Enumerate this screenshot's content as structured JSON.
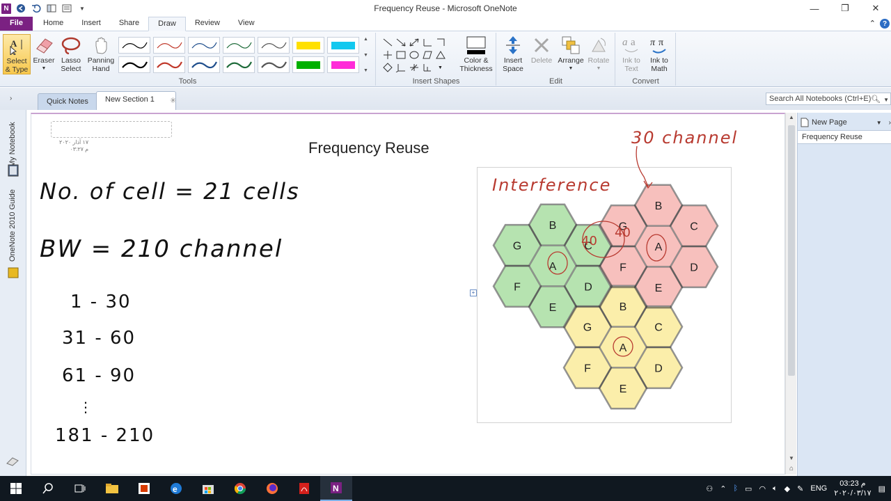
{
  "window": {
    "title": "Frequency Reuse - Microsoft OneNote",
    "app_icon": "N"
  },
  "ribbon_tabs": [
    "File",
    "Home",
    "Insert",
    "Share",
    "Draw",
    "Review",
    "View"
  ],
  "active_tab": "Draw",
  "ribbon": {
    "tools_buttons": {
      "select_type": "Select & Type",
      "eraser": "Eraser",
      "lasso": "Lasso Select",
      "panning": "Panning Hand"
    },
    "tools_label": "Tools",
    "color_thickness": "Color & Thickness",
    "insert_shapes_label": "Insert Shapes",
    "edit_buttons": {
      "insert_space": "Insert Space",
      "delete": "Delete",
      "arrange": "Arrange",
      "rotate": "Rotate"
    },
    "edit_label": "Edit",
    "convert_buttons": {
      "ink_to_text": "Ink to Text",
      "ink_to_math": "Ink to Math"
    },
    "convert_label": "Convert",
    "pen_colors": [
      "#000000",
      "#c0392b",
      "#1f4e8c",
      "#1e6b3a",
      "#555555",
      "#ffe000",
      "#12c8ef",
      "#000000",
      "#c0392b",
      "#1f4e8c",
      "#1e6b3a",
      "#555555",
      "#00b000",
      "#ff2bd8"
    ]
  },
  "sections": {
    "quick_notes": "Quick Notes",
    "new_section": "New Section 1"
  },
  "search": {
    "placeholder": "Search All Notebooks (Ctrl+E)"
  },
  "notebook_bar": {
    "my_notebook": "My Notebook",
    "guide": "OneNote 2010 Guide"
  },
  "page": {
    "title": "Frequency Reuse",
    "date_line1": "١٧ آذار ٢٠٢٠",
    "date_line2": "م ٠٣:٢٧"
  },
  "handwriting": {
    "cells": "No. of cell = 21 cells",
    "bw": "BW = 210 channel",
    "range1": "1 - 30",
    "range2": "31 - 60",
    "range3": "61 - 90",
    "dots": "⋮",
    "range4": "181 - 210",
    "note_30": "30 channel",
    "note_interference": "Interference",
    "note_40a": "40",
    "note_40b": "40"
  },
  "hex_clusters": {
    "colors": {
      "green": "#b6e3b0",
      "red": "#f7c0bd",
      "yellow": "#fbeeaa",
      "stroke": "#3a3a3a"
    },
    "green": [
      "B",
      "G",
      "A",
      "D",
      "F",
      "E",
      "C"
    ],
    "red": [
      "B",
      "G",
      "C",
      "A",
      "F",
      "D",
      "E"
    ],
    "yellow": [
      "B",
      "G",
      "C",
      "A",
      "F",
      "D",
      "E"
    ]
  },
  "page_list": {
    "new_page": "New Page",
    "items": [
      "Frequency Reuse"
    ]
  },
  "taskbar": {
    "lang": "ENG",
    "time": "03:23 م",
    "date": "٢٠٢٠/٠٣/١٧"
  }
}
